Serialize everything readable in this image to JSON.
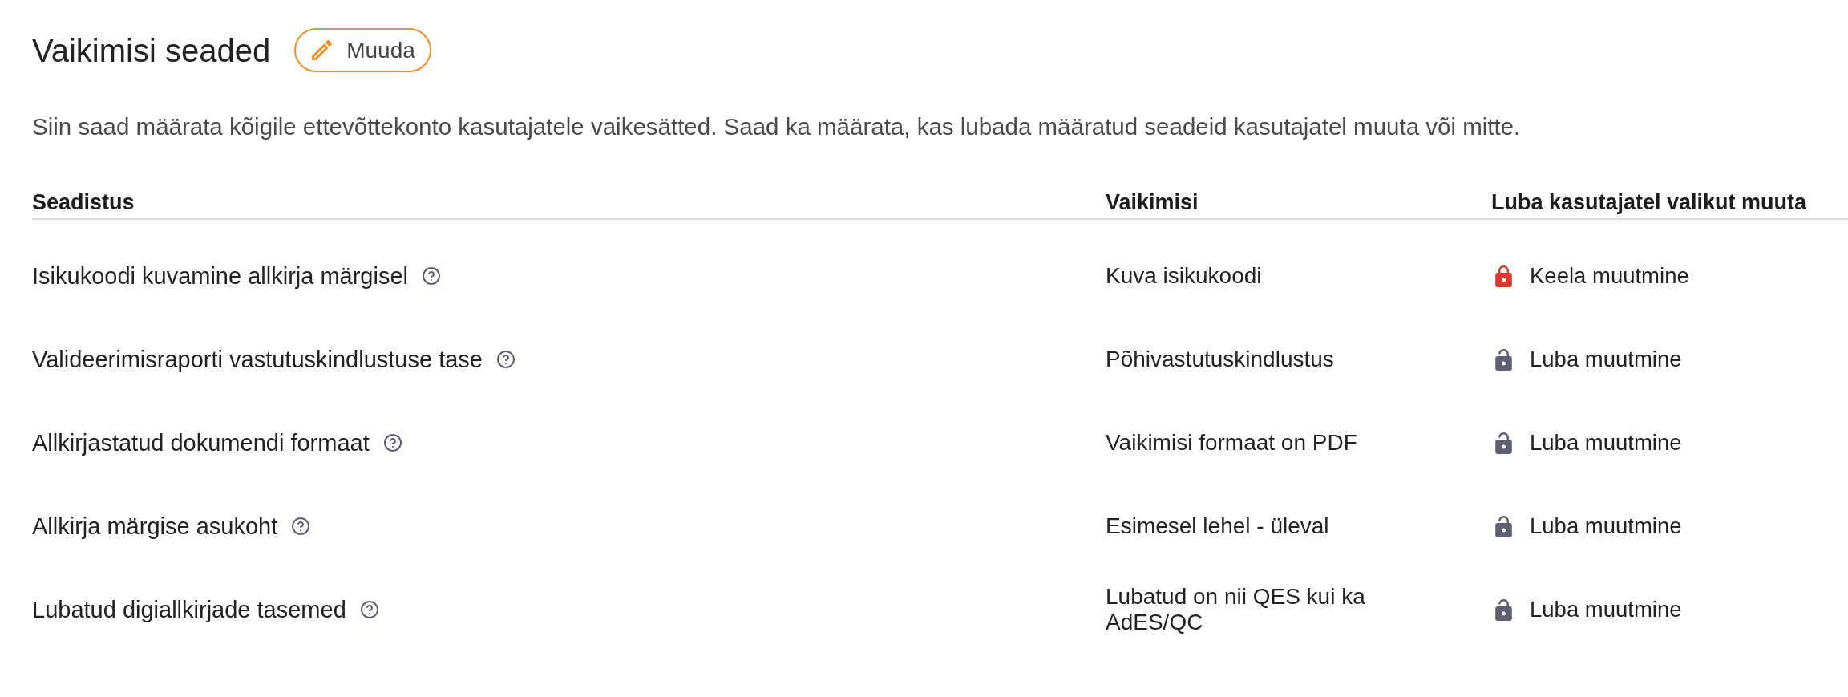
{
  "header": {
    "title": "Vaikimisi seaded",
    "edit_button": {
      "label": "Muuda"
    }
  },
  "description": "Siin saad määrata kõigile ettevõttekonto kasutajatele vaikesätted. Saad ka määrata, kas lubada määratud seadeid kasutajatel muuta või mitte.",
  "table": {
    "columns": [
      "Seadistus",
      "Vaikimisi",
      "Luba kasutajatel valikut muuta"
    ],
    "rows": [
      {
        "setting": "Isikukoodi kuvamine allkirja märgisel",
        "default": "Kuva isikukoodi",
        "permission": {
          "label": "Keela muutmine",
          "locked": true
        }
      },
      {
        "setting": "Valideerimisraporti vastutuskindlustuse tase",
        "default": "Põhivastutuskindlustus",
        "permission": {
          "label": "Luba muutmine",
          "locked": false
        }
      },
      {
        "setting": "Allkirjastatud dokumendi formaat",
        "default": "Vaikimisi formaat on PDF",
        "permission": {
          "label": "Luba muutmine",
          "locked": false
        }
      },
      {
        "setting": "Allkirja märgise asukoht",
        "default": "Esimesel lehel - üleval",
        "permission": {
          "label": "Luba muutmine",
          "locked": false
        }
      },
      {
        "setting": "Lubatud digiallkirjade tasemed",
        "default": "Lubatud on nii QES kui ka AdES/QC",
        "permission": {
          "label": "Luba muutmine",
          "locked": false
        }
      }
    ]
  }
}
